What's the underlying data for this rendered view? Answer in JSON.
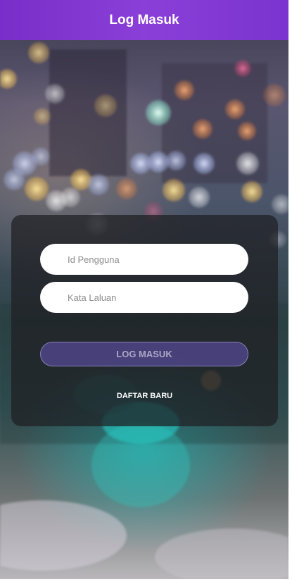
{
  "header": {
    "title": "Log Masuk",
    "color": "#7f38d2"
  },
  "login_form": {
    "username": {
      "value": "",
      "placeholder": "Id Pengguna"
    },
    "password": {
      "value": "",
      "placeholder": "Kata Laluan"
    },
    "login_label": "LOG MASUK",
    "register_label": "DAFTAR BARU",
    "accent_color": "#6050aa"
  },
  "background": {
    "type": "blurred-city-bokeh-photo"
  }
}
